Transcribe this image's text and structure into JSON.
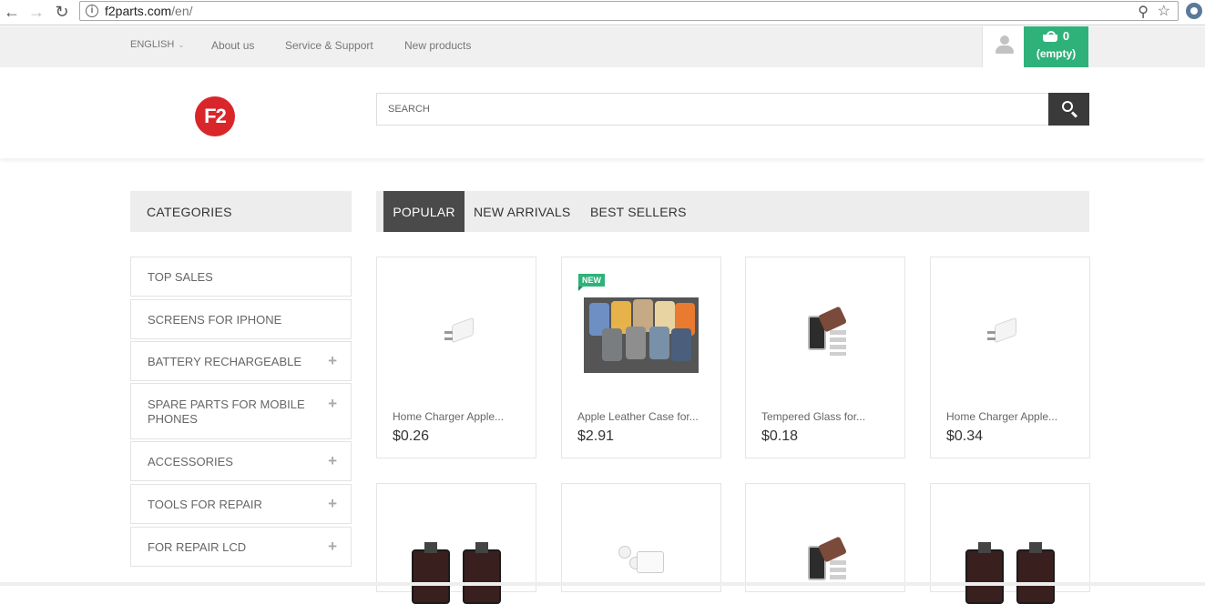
{
  "browser": {
    "url_host": "f2parts.com",
    "url_path": "/en/"
  },
  "topbar": {
    "language": "ENGLISH",
    "links": [
      "About us",
      "Service & Support",
      "New products"
    ],
    "cart_count": "0",
    "cart_status": "(empty)"
  },
  "header": {
    "logo_text": "F2",
    "search_placeholder": "SEARCH"
  },
  "categories": {
    "title": "CATEGORIES",
    "items": [
      {
        "label": "TOP SALES",
        "expandable": false
      },
      {
        "label": "SCREENS FOR IPHONE",
        "expandable": false
      },
      {
        "label": "BATTERY RECHARGEABLE",
        "expandable": true
      },
      {
        "label": "SPARE PARTS FOR MOBILE PHONES",
        "expandable": true
      },
      {
        "label": "ACCESSORIES",
        "expandable": true
      },
      {
        "label": "TOOLS FOR REPAIR",
        "expandable": true
      },
      {
        "label": "FOR REPAIR LCD",
        "expandable": true
      }
    ]
  },
  "tabs": [
    {
      "label": "POPULAR",
      "active": true
    },
    {
      "label": "NEW ARRIVALS",
      "active": false
    },
    {
      "label": "BEST SELLERS",
      "active": false
    }
  ],
  "products": [
    {
      "name": "Home Charger Apple...",
      "price": "$0.26",
      "image": "charger",
      "badge": ""
    },
    {
      "name": "Apple Leather Case for...",
      "price": "$2.91",
      "image": "cases",
      "badge": "NEW"
    },
    {
      "name": "Tempered Glass for...",
      "price": "$0.18",
      "image": "tempered-glass",
      "badge": ""
    },
    {
      "name": "Home Charger Apple...",
      "price": "$0.34",
      "image": "charger",
      "badge": ""
    }
  ],
  "products_row2": [
    {
      "image": "lcd"
    },
    {
      "image": "earpods"
    },
    {
      "image": "tempered-glass"
    },
    {
      "image": "lcd"
    }
  ],
  "colors": {
    "accent_green": "#2fb27a",
    "logo_red": "#d9262b",
    "active_tab": "#4a4a4a"
  }
}
